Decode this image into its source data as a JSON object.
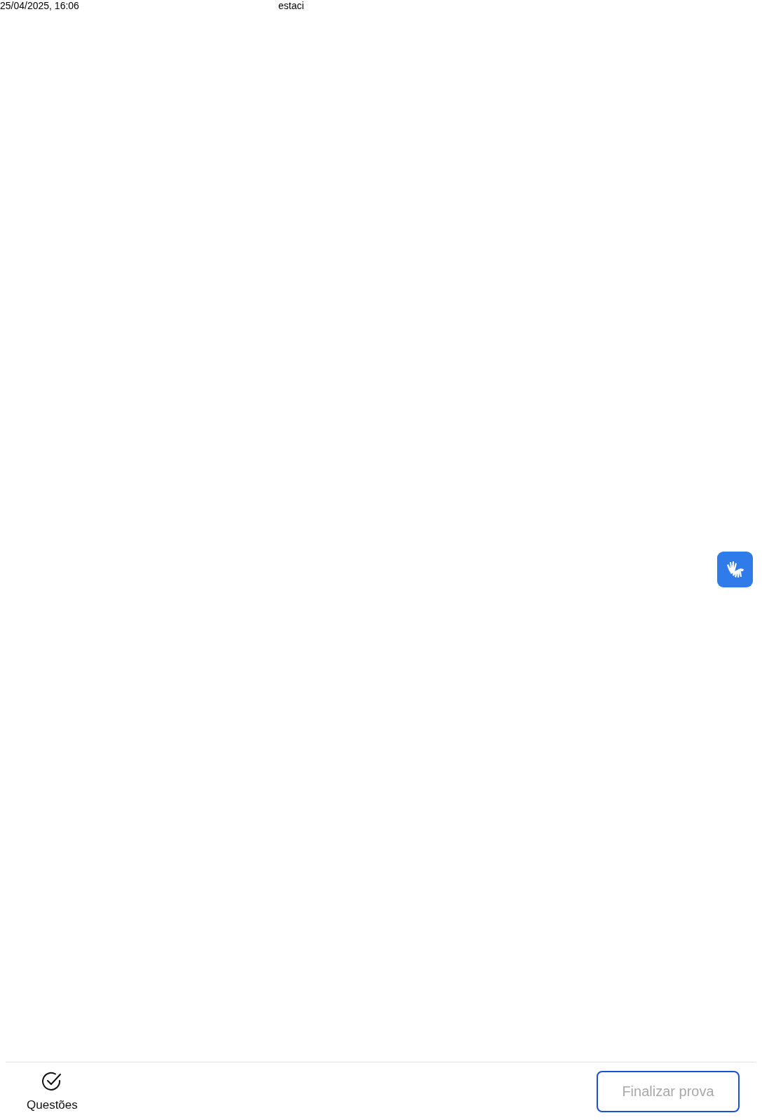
{
  "print_header": {
    "datetime": "25/04/2025, 16:06",
    "title": "estaci"
  },
  "footer": {
    "questions_label": "Questões",
    "finish_button": {
      "label": "Finalizar prova",
      "disabled": true
    }
  }
}
